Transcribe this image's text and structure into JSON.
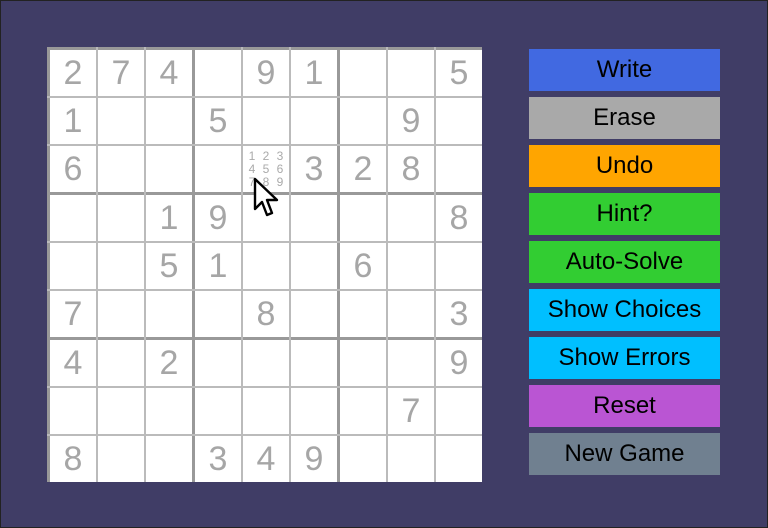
{
  "board": {
    "givens": [
      [
        2,
        7,
        4,
        0,
        9,
        1,
        0,
        0,
        5
      ],
      [
        1,
        0,
        0,
        5,
        0,
        0,
        0,
        9,
        0
      ],
      [
        6,
        0,
        0,
        0,
        0,
        3,
        2,
        8,
        0
      ],
      [
        0,
        0,
        1,
        9,
        0,
        0,
        0,
        0,
        8
      ],
      [
        0,
        0,
        5,
        1,
        0,
        0,
        6,
        0,
        0
      ],
      [
        7,
        0,
        0,
        0,
        8,
        0,
        0,
        0,
        3
      ],
      [
        4,
        0,
        2,
        0,
        0,
        0,
        0,
        0,
        9
      ],
      [
        0,
        0,
        0,
        0,
        0,
        0,
        0,
        7,
        0
      ],
      [
        8,
        0,
        0,
        3,
        4,
        9,
        0,
        0,
        0
      ]
    ],
    "candidate_cell": {
      "row": 3,
      "col": 5,
      "candidates": [
        "1",
        "2",
        "3",
        "4",
        "5",
        "6",
        "7",
        "8",
        "9"
      ]
    }
  },
  "buttons": [
    {
      "label": "Write",
      "color": "#4169e1"
    },
    {
      "label": "Erase",
      "color": "#a9a9a9"
    },
    {
      "label": "Undo",
      "color": "#ffa500"
    },
    {
      "label": "Hint?",
      "color": "#32cd32"
    },
    {
      "label": "Auto-Solve",
      "color": "#32cd32"
    },
    {
      "label": "Show Choices",
      "color": "#00bfff"
    },
    {
      "label": "Show Errors",
      "color": "#00bfff"
    },
    {
      "label": "Reset",
      "color": "#ba55d3"
    },
    {
      "label": "New Game",
      "color": "#708090"
    }
  ],
  "colors": {
    "background": "#403d66",
    "digit": "#a6a6a6"
  },
  "cursor_icon": "arrow-pointer"
}
